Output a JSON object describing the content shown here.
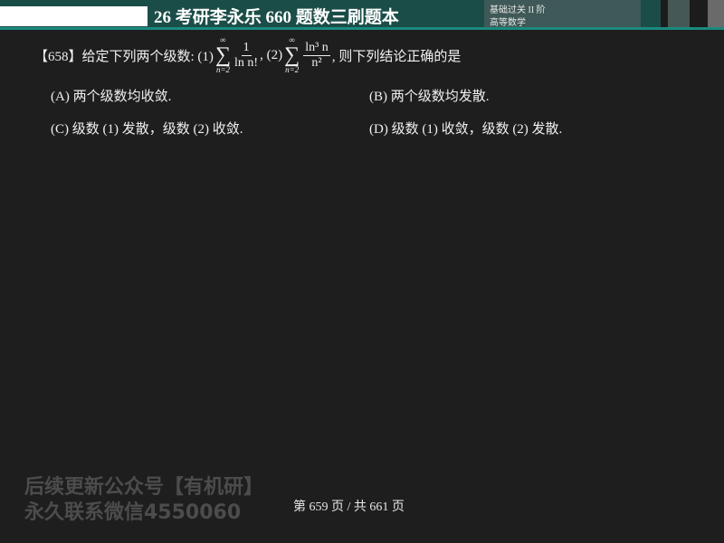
{
  "header": {
    "title": "26 考研李永乐 660 题数三刷题本",
    "section_line1": "基础过关 II 阶",
    "section_line2": "高等数学"
  },
  "question": {
    "number": "【658】",
    "stem_prefix": "给定下列两个级数: (1)",
    "sum_top": "∞",
    "sum_symbol": "∑",
    "sum_bottom": "n=2",
    "series1_num": "1",
    "series1_den": "ln n!",
    "sep": ", (2)",
    "series2_num": "ln³ n",
    "series2_den": "n²",
    "stem_suffix": ", 则下列结论正确的是",
    "options": [
      "(A) 两个级数均收敛.",
      "(B) 两个级数均发散.",
      "(C) 级数 (1) 发散，级数 (2) 收敛.",
      "(D) 级数 (1) 收敛，级数 (2) 发散."
    ]
  },
  "watermark": {
    "line1": "后续更新公众号【有机研】",
    "line2": "永久联系微信4550060"
  },
  "footer": {
    "page": "第 659 页 / 共 661 页"
  }
}
